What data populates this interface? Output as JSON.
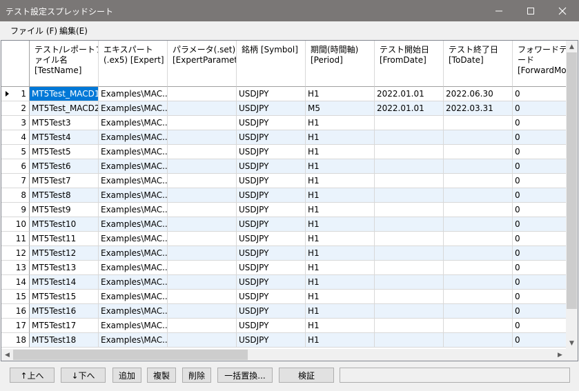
{
  "window": {
    "title": "テスト設定スプレッドシート"
  },
  "menu": {
    "file": "ファイル (F)",
    "edit": "編集(E)"
  },
  "columns": [
    "テスト/レポートフ\nァイル名\n[TestName]",
    "エキスパート\n(.ex5) [Expert]",
    "パラメータ(.set)\n[ExpertParameters]",
    "銘柄 [Symbol]",
    "期間(時間軸)\n[Period]",
    "テスト開始日\n[FromDate]",
    "テスト終了日\n[ToDate]",
    "フォワードテス\nード\n[ForwardMode]"
  ],
  "rows": [
    {
      "num": "1",
      "cells": [
        "MT5Test_MACD1",
        "Examples\\MAC...",
        "",
        "USDJPY",
        "H1",
        "2022.01.01",
        "2022.06.30",
        "0"
      ]
    },
    {
      "num": "2",
      "cells": [
        "MT5Test_MACD2",
        "Examples\\MAC...",
        "",
        "USDJPY",
        "M5",
        "2022.01.01",
        "2022.03.31",
        "0"
      ]
    },
    {
      "num": "3",
      "cells": [
        "MT5Test3",
        "Examples\\MAC...",
        "",
        "USDJPY",
        "H1",
        "",
        "",
        "0"
      ]
    },
    {
      "num": "4",
      "cells": [
        "MT5Test4",
        "Examples\\MAC...",
        "",
        "USDJPY",
        "H1",
        "",
        "",
        "0"
      ]
    },
    {
      "num": "5",
      "cells": [
        "MT5Test5",
        "Examples\\MAC...",
        "",
        "USDJPY",
        "H1",
        "",
        "",
        "0"
      ]
    },
    {
      "num": "6",
      "cells": [
        "MT5Test6",
        "Examples\\MAC...",
        "",
        "USDJPY",
        "H1",
        "",
        "",
        "0"
      ]
    },
    {
      "num": "7",
      "cells": [
        "MT5Test7",
        "Examples\\MAC...",
        "",
        "USDJPY",
        "H1",
        "",
        "",
        "0"
      ]
    },
    {
      "num": "8",
      "cells": [
        "MT5Test8",
        "Examples\\MAC...",
        "",
        "USDJPY",
        "H1",
        "",
        "",
        "0"
      ]
    },
    {
      "num": "9",
      "cells": [
        "MT5Test9",
        "Examples\\MAC...",
        "",
        "USDJPY",
        "H1",
        "",
        "",
        "0"
      ]
    },
    {
      "num": "10",
      "cells": [
        "MT5Test10",
        "Examples\\MAC...",
        "",
        "USDJPY",
        "H1",
        "",
        "",
        "0"
      ]
    },
    {
      "num": "11",
      "cells": [
        "MT5Test11",
        "Examples\\MAC...",
        "",
        "USDJPY",
        "H1",
        "",
        "",
        "0"
      ]
    },
    {
      "num": "12",
      "cells": [
        "MT5Test12",
        "Examples\\MAC...",
        "",
        "USDJPY",
        "H1",
        "",
        "",
        "0"
      ]
    },
    {
      "num": "13",
      "cells": [
        "MT5Test13",
        "Examples\\MAC...",
        "",
        "USDJPY",
        "H1",
        "",
        "",
        "0"
      ]
    },
    {
      "num": "14",
      "cells": [
        "MT5Test14",
        "Examples\\MAC...",
        "",
        "USDJPY",
        "H1",
        "",
        "",
        "0"
      ]
    },
    {
      "num": "15",
      "cells": [
        "MT5Test15",
        "Examples\\MAC...",
        "",
        "USDJPY",
        "H1",
        "",
        "",
        "0"
      ]
    },
    {
      "num": "16",
      "cells": [
        "MT5Test16",
        "Examples\\MAC...",
        "",
        "USDJPY",
        "H1",
        "",
        "",
        "0"
      ]
    },
    {
      "num": "17",
      "cells": [
        "MT5Test17",
        "Examples\\MAC...",
        "",
        "USDJPY",
        "H1",
        "",
        "",
        "0"
      ]
    },
    {
      "num": "18",
      "cells": [
        "MT5Test18",
        "Examples\\MAC...",
        "",
        "USDJPY",
        "H1",
        "",
        "",
        "0"
      ]
    }
  ],
  "buttons": {
    "up": "↑上へ",
    "down": "↓下へ",
    "add": "追加",
    "duplicate": "複製",
    "delete": "削除",
    "bulk_replace": "一括置換...",
    "verify": "検証"
  },
  "colors": {
    "alt_row": "#eaf3fc",
    "row": "#ffffff",
    "selection": "#0078d7",
    "titlebar": "#7a7776"
  }
}
